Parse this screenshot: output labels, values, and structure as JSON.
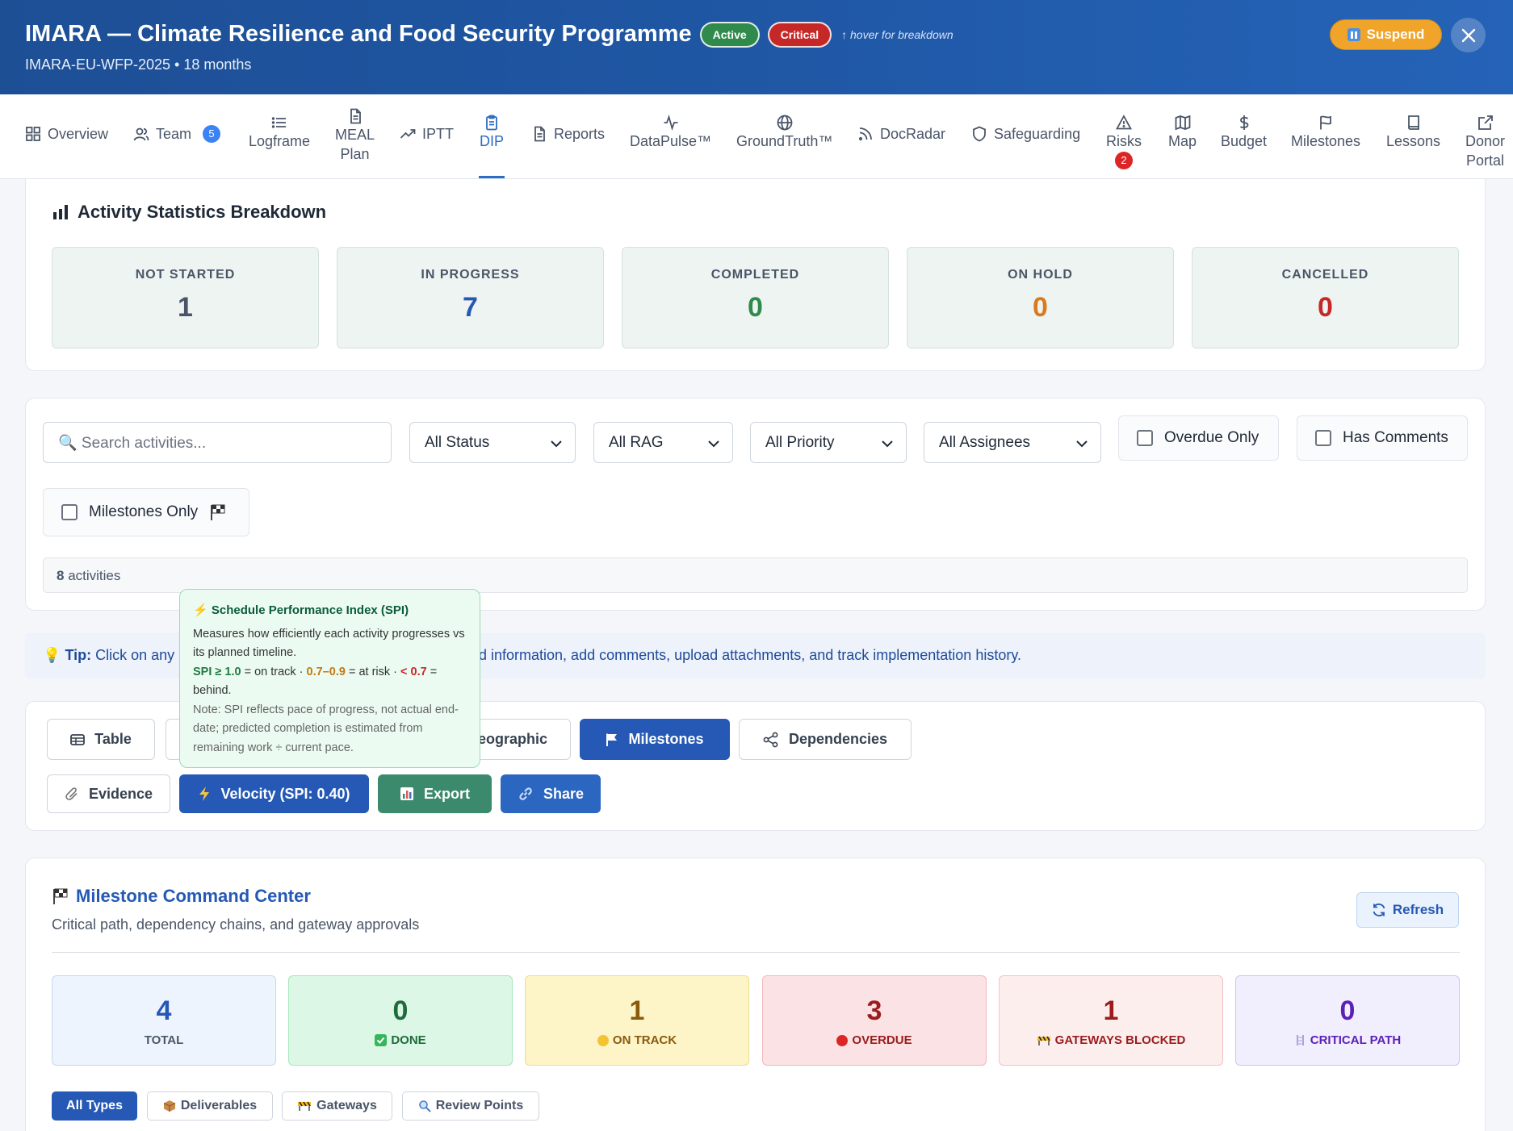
{
  "header": {
    "title": "IMARA — Climate Resilience and Food Security Programme",
    "status_badge": "Active",
    "risk_badge": "Critical",
    "hover_hint": "↑ hover for breakdown",
    "subtitle": "IMARA-EU-WFP-2025 • 18 months",
    "suspend_label": "Suspend"
  },
  "tabs": {
    "overview": "Overview",
    "team": "Team",
    "team_count": "5",
    "logframe": "Logframe",
    "meal_line1": "MEAL",
    "meal_line2": "Plan",
    "iptt": "IPTT",
    "dip": "DIP",
    "reports": "Reports",
    "datapulse": "DataPulse™",
    "groundtruth": "GroundTruth™",
    "docradar": "DocRadar",
    "safeguarding": "Safeguarding",
    "risks": "Risks",
    "risks_count": "2",
    "map": "Map",
    "budget": "Budget",
    "milestones": "Milestones",
    "lessons": "Lessons",
    "donor_line1": "Donor",
    "donor_line2": "Portal"
  },
  "stats": {
    "title": "Activity Statistics Breakdown",
    "items": [
      {
        "label": "NOT STARTED",
        "value": "1",
        "color": "#4a5568"
      },
      {
        "label": "IN PROGRESS",
        "value": "7",
        "color": "#2559b5"
      },
      {
        "label": "COMPLETED",
        "value": "0",
        "color": "#2f8a4c"
      },
      {
        "label": "ON HOLD",
        "value": "0",
        "color": "#d97a1c"
      },
      {
        "label": "CANCELLED",
        "value": "0",
        "color": "#c62828"
      }
    ]
  },
  "filters": {
    "search_placeholder": "🔍 Search activities...",
    "status": "All Status",
    "rag": "All RAG",
    "priority": "All Priority",
    "assignees": "All Assignees",
    "overdue_only": "Overdue Only",
    "has_comments": "Has Comments",
    "milestones_only": "Milestones Only",
    "count_number": "8",
    "count_suffix": " activities"
  },
  "tip": {
    "label": "Tip:",
    "text_start": "Click on any",
    "text_end": "d information, add comments, upload attachments, and track implementation history."
  },
  "tooltip": {
    "title": "⚡ Schedule Performance Index (SPI)",
    "line1": "Measures how efficiently each activity progresses vs its planned timeline.",
    "spi_good": "SPI ≥ 1.0",
    "good_text": " = on track · ",
    "spi_risk": "0.7–0.9",
    "risk_text": " = at risk · ",
    "spi_bad": "< 0.7",
    "bad_text": " = behind.",
    "note": "Note: SPI reflects pace of progress, not actual end-date; predicted completion is estimated from remaining work ÷ current pace."
  },
  "views": {
    "table": "Table",
    "geographic": "eographic",
    "milestones": "Milestones",
    "dependencies": "Dependencies",
    "evidence": "Evidence",
    "velocity": "Velocity  (SPI: 0.40)",
    "export": "Export",
    "share": "Share"
  },
  "milestone_center": {
    "title": "Milestone Command Center",
    "subtitle": "Critical path, dependency chains, and gateway approvals",
    "refresh": "Refresh",
    "stats": [
      {
        "value": "4",
        "label": "TOTAL"
      },
      {
        "value": "0",
        "label": "DONE"
      },
      {
        "value": "1",
        "label": "ON TRACK"
      },
      {
        "value": "3",
        "label": "OVERDUE"
      },
      {
        "value": "1",
        "label": "GATEWAYS BLOCKED"
      },
      {
        "value": "0",
        "label": "CRITICAL PATH"
      }
    ],
    "chips": {
      "all": "All Types",
      "deliverables": "Deliverables",
      "gateways": "Gateways",
      "review": "Review Points"
    }
  }
}
